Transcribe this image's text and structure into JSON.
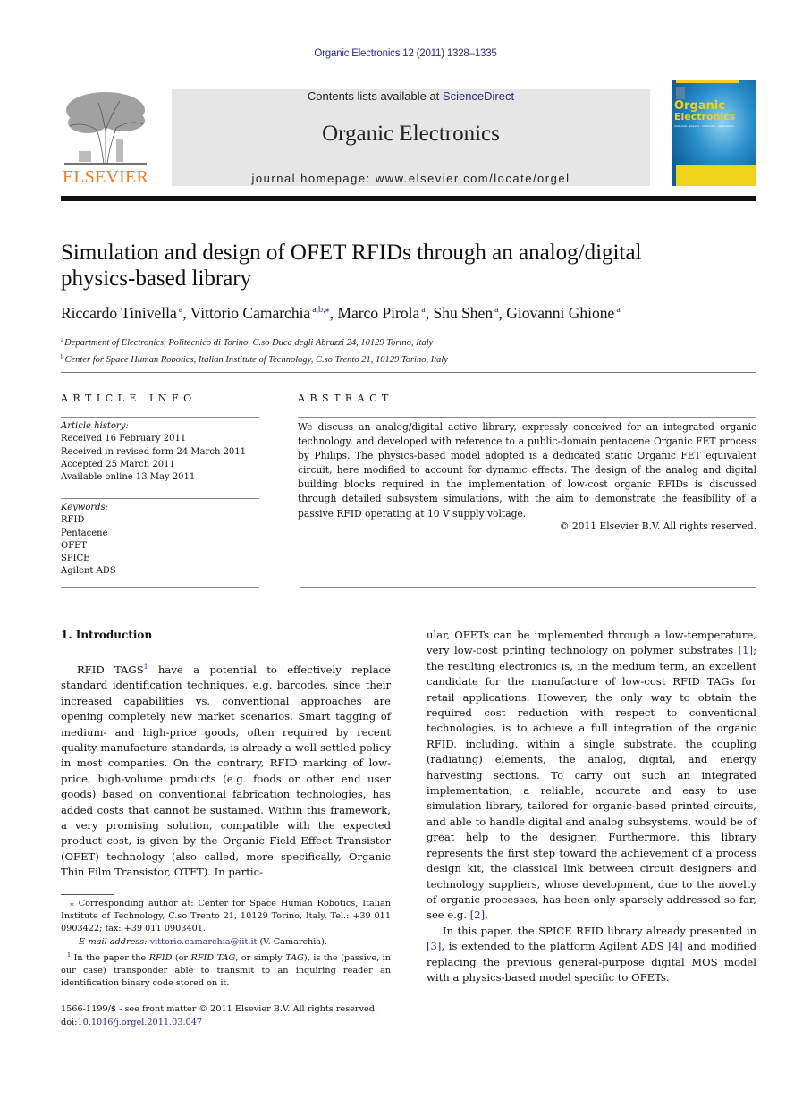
{
  "header": {
    "journal_ref": "Organic Electronics 12 (2011) 1328–1335",
    "contents_prefix": "Contents lists available at ",
    "contents_link": "ScienceDirect",
    "journal_name": "Organic Electronics",
    "homepage": "journal homepage: www.elsevier.com/locate/orgel",
    "publisher_logo_text": "ELSEVIER",
    "cover_title_1": "Organic",
    "cover_title_2": "Electronics",
    "cover_subtitle": "materials · physics · chemistry · applications"
  },
  "colors": {
    "link": "#2a2a8c",
    "elsevier_orange": "#f07a1a",
    "header_box": "#e6e6e6",
    "cover_yellow": "#f1d21a",
    "cover_blue": "#2a90cc"
  },
  "article": {
    "title_line1": "Simulation and design of OFET RFIDs through an analog/digital",
    "title_line2": "physics-based library",
    "authors": [
      {
        "name": "Riccardo Tinivella",
        "aff": "a"
      },
      {
        "name": "Vittorio Camarchia",
        "aff": "a,b,⁎"
      },
      {
        "name": "Marco Pirola",
        "aff": "a"
      },
      {
        "name": "Shu Shen",
        "aff": "a"
      },
      {
        "name": "Giovanni Ghione",
        "aff": "a"
      }
    ],
    "affiliations": [
      {
        "mark": "a",
        "text": "Department of Electronics, Politecnico di Torino, C.so Duca degli Abruzzi 24, 10129 Torino, Italy"
      },
      {
        "mark": "b",
        "text": "Center for Space Human Robotics, Italian Institute of Technology, C.so Trento 21, 10129 Torino, Italy"
      }
    ]
  },
  "article_info": {
    "heading": "ARTICLE INFO",
    "history_label": "Article history:",
    "history": [
      "Received 16 February 2011",
      "Received in revised form 24 March 2011",
      "Accepted 25 March 2011",
      "Available online 13 May 2011"
    ],
    "keywords_label": "Keywords:",
    "keywords": [
      "RFID",
      "Pentacene",
      "OFET",
      "SPICE",
      "Agilent ADS"
    ]
  },
  "abstract": {
    "heading": "ABSTRACT",
    "text": "We discuss an analog/digital active library, expressly conceived for an integrated organic technology, and developed with reference to a public-domain pentacene Organic FET process by Philips. The physics-based model adopted is a dedicated static Organic FET equivalent circuit, here modified to account for dynamic effects. The design of the analog and digital building blocks required in the implementation of low-cost organic RFIDs is discussed through detailed subsystem simulations, with the aim to demonstrate the feasibility of a passive RFID operating at 10 V supply voltage.",
    "copyright": "© 2011 Elsevier B.V. All rights reserved."
  },
  "body": {
    "section_heading": "1. Introduction",
    "left_p1_a": "RFID TAGS",
    "left_p1_fn": "1",
    "left_p1_b": " have a potential to effectively replace standard identification techniques, e.g. barcodes, since their increased capabilities vs. conventional approaches are opening completely new market scenarios. Smart tagging of medium- and high-price goods, often required by recent quality manufacture standards, is already a well settled policy in most companies. On the contrary, RFID marking of low-price, high-volume products (e.g. foods or other end user goods) based on conventional fabrication technologies, has added costs that cannot be sustained. Within this framework, a very promising solution, compatible with the expected product cost, is given by the Organic Field Effect Transistor (OFET) technology (also called, more specifically, Organic Thin Film Transistor, OTFT). In partic-",
    "right_p1_a": "ular, OFETs can be implemented through a low-temperature, very low-cost printing technology on polymer substrates ",
    "ref1": "[1]",
    "right_p1_b": "; the resulting electronics is, in the medium term, an excellent candidate for the manufacture of low-cost RFID TAGs for retail applications. However, the only way to obtain the required cost reduction with respect to conventional technologies, is to achieve a full integration of the organic RFID, including, within a single substrate, the coupling (radiating) elements, the analog, digital, and energy harvesting sections. To carry out such an integrated implementation, a reliable, accurate and easy to use simulation library, tailored for organic-based printed circuits, and able to handle digital and analog subsystems, would be of great help to the designer. Furthermore, this library represents the first step toward the achievement of a process design kit, the classical link between circuit designers and technology suppliers, whose development, due to the novelty of organic processes, has been only sparsely addressed so far, see e.g. ",
    "ref2": "[2]",
    "right_p1_c": ".",
    "right_p2_a": "In this paper, the SPICE RFID library already presented in ",
    "ref3": "[3]",
    "right_p2_b": ", is extended to the platform Agilent ADS ",
    "ref4": "[4]",
    "right_p2_c": " and modified replacing the previous general-purpose digital MOS model with a physics-based model specific to OFETs."
  },
  "footnotes": {
    "corresponding_mark": "⁎",
    "corresponding": " Corresponding author at: Center for Space Human Robotics, Italian Institute of Technology, C.so Trento 21, 10129 Torino, Italy. Tel.: +39 011 0903422; fax: +39 011 0903401.",
    "email_label": "E-mail address: ",
    "email": "vittorio.camarchia@iit.it",
    "email_suffix": " (V. Camarchia).",
    "fn1_mark": "1",
    "fn1_a": " In the paper the ",
    "fn1_rfid": "RFID",
    "fn1_b": " (or ",
    "fn1_rfidtag": "RFID TAG",
    "fn1_c": ", or simply ",
    "fn1_tag": "TAG",
    "fn1_d": "), is the (passive, in our case) transponder able to transmit to an inquiring reader an identification binary code stored on it."
  },
  "front_matter": {
    "issn_line": "1566-1199/$ - see front matter © 2011 Elsevier B.V. All rights reserved.",
    "doi_label": "doi:",
    "doi": "10.1016/j.orgel.2011.03.047"
  }
}
